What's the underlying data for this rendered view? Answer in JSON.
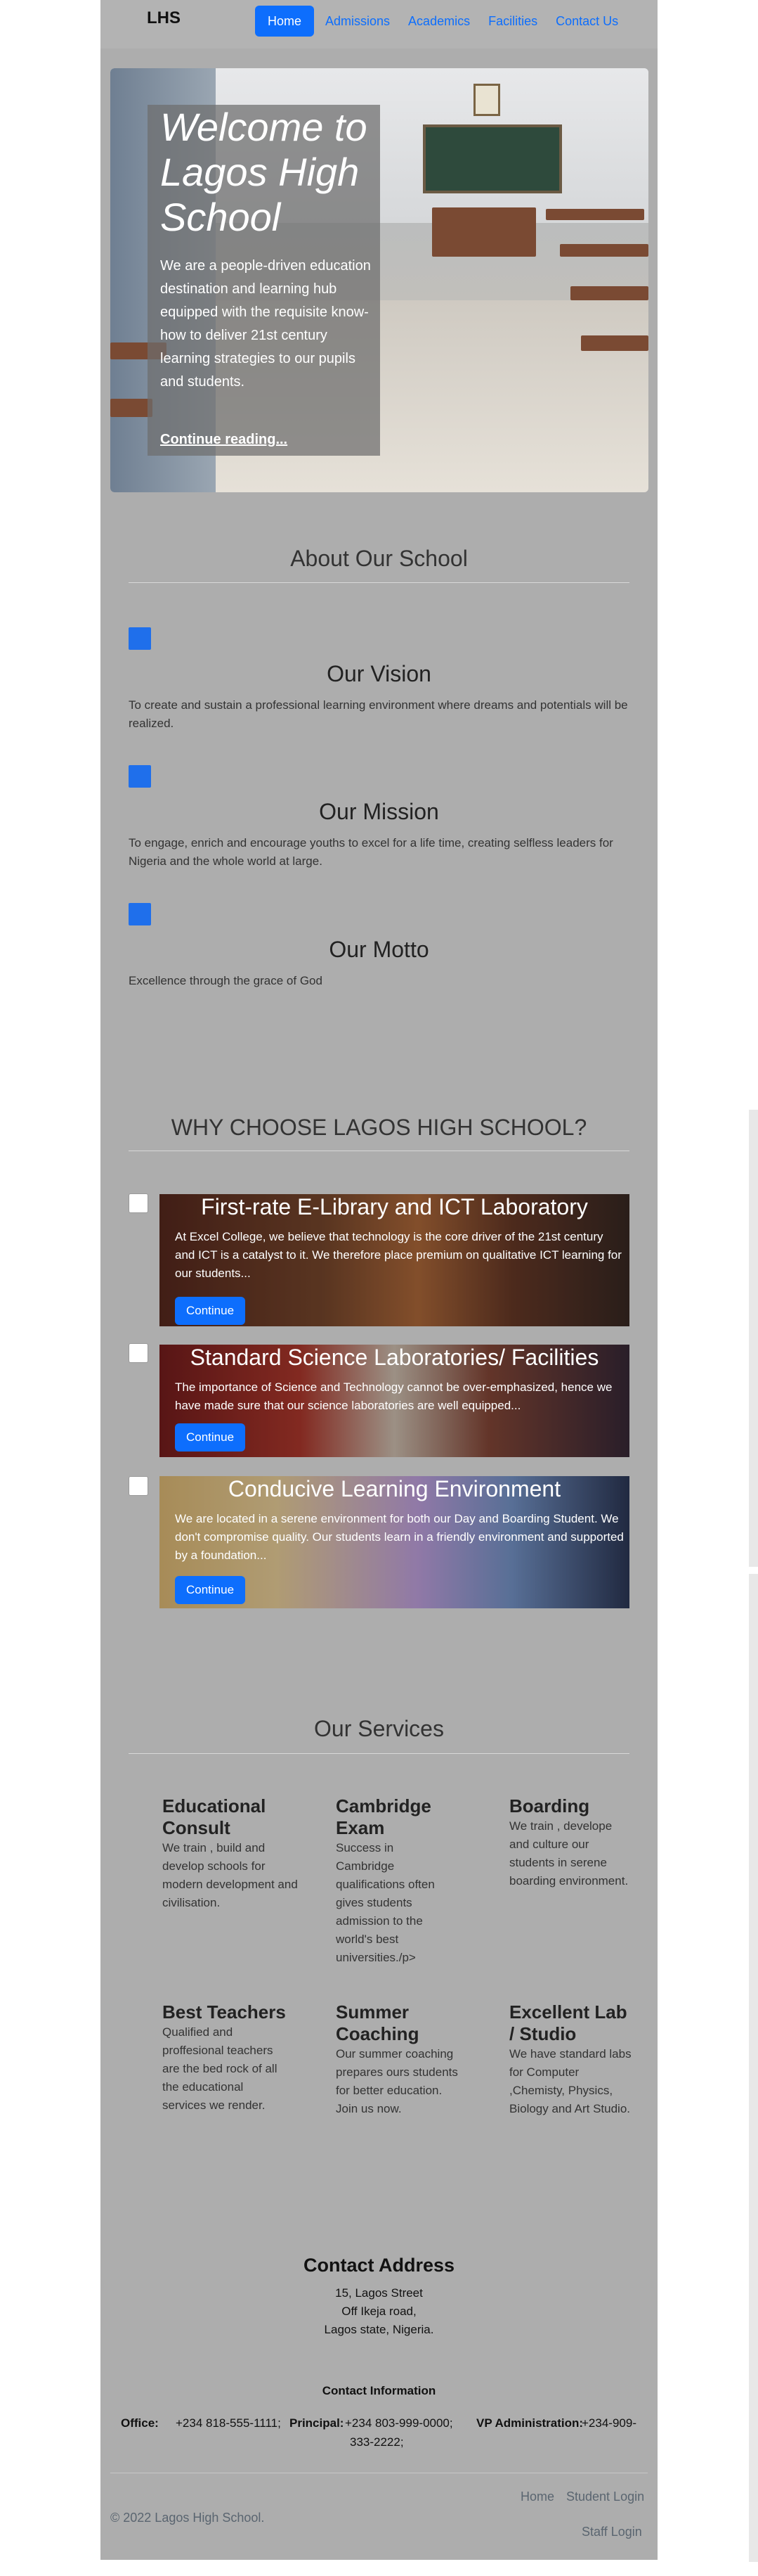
{
  "nav": {
    "brand": "LHS",
    "links": [
      "Home",
      "Admissions",
      "Academics",
      "Facilities",
      "Contact Us"
    ]
  },
  "hero": {
    "title": "Welcome to Lagos High School",
    "lead": "We are a people-driven education destination and learning hub equipped with the requisite know-how to deliver 21st century learning strategies to our pupils and students.",
    "link": "Continue reading..."
  },
  "about": {
    "heading": "About Our School",
    "items": [
      {
        "title": "Our Vision",
        "text": "To create and sustain a professional learning environment where dreams and potentials will be realized."
      },
      {
        "title": "Our Mission",
        "text": "To engage, enrich and encourage youths to excel for a life time, creating selfless leaders for Nigeria and the whole world at large."
      },
      {
        "title": "Our Motto",
        "text": "Excellence through the grace of God"
      }
    ]
  },
  "why": {
    "heading": "WHY CHOOSE LAGOS HIGH SCHOOL?",
    "cards": [
      {
        "title": "First-rate E-Library and ICT Laboratory",
        "text": "At Excel College, we believe that technology is the core driver of the 21st century and ICT is a catalyst to it. We therefore place premium on qualitative ICT learning for our students...",
        "button": "Continue"
      },
      {
        "title": "Standard Science Laboratories/ Facilities",
        "text": "The importance of Science and Technology cannot be over-emphasized, hence we have made sure that our science laboratories are well equipped...",
        "button": "Continue"
      },
      {
        "title": "Conducive Learning Environment",
        "text": "We are located in a serene environment for both our Day and Boarding Student. We don't compromise quality. Our students learn in a friendly environment and supported by a foundation...",
        "button": "Continue"
      }
    ]
  },
  "services": {
    "heading": "Our Services",
    "items": [
      {
        "title": "Educational Consult",
        "text": "We train , build and develop schools for modern development and civilisation."
      },
      {
        "title": "Cambridge Exam",
        "text": "Success in Cambridge qualifications often gives students admission to the world's best universities./p>"
      },
      {
        "title": "Boarding",
        "text": "We train , develope and culture our students in serene boarding environment."
      },
      {
        "title": "Best Teachers",
        "text": "Qualified and proffesional teachers are the bed rock of all the educational services we render."
      },
      {
        "title": "Summer Coaching",
        "text": "Our summer coaching prepares ours students for better education. Join us now."
      },
      {
        "title": "Excellent Lab / Studio",
        "text": "We have standard labs for Computer ,Chemisty, Physics, Biology and Art Studio."
      }
    ]
  },
  "contact": {
    "heading": "Contact Address",
    "address": [
      "15, Lagos Street",
      "Off Ikeja road,",
      "Lagos state, Nigeria."
    ],
    "info_heading": "Contact Information",
    "office_label": "Office:",
    "office_value": "+234 818-555-1111;",
    "principal_label": "Principal:",
    "principal_value": "+234 803-999-0000;",
    "vp_label": "VP Administration:",
    "vp_value": "+234-909-",
    "vp_value_cont": "333-2222;"
  },
  "footer": {
    "copyright": "© 2022 Lagos High School.",
    "links": [
      "Home",
      "Student Login",
      "Staff Login"
    ]
  }
}
